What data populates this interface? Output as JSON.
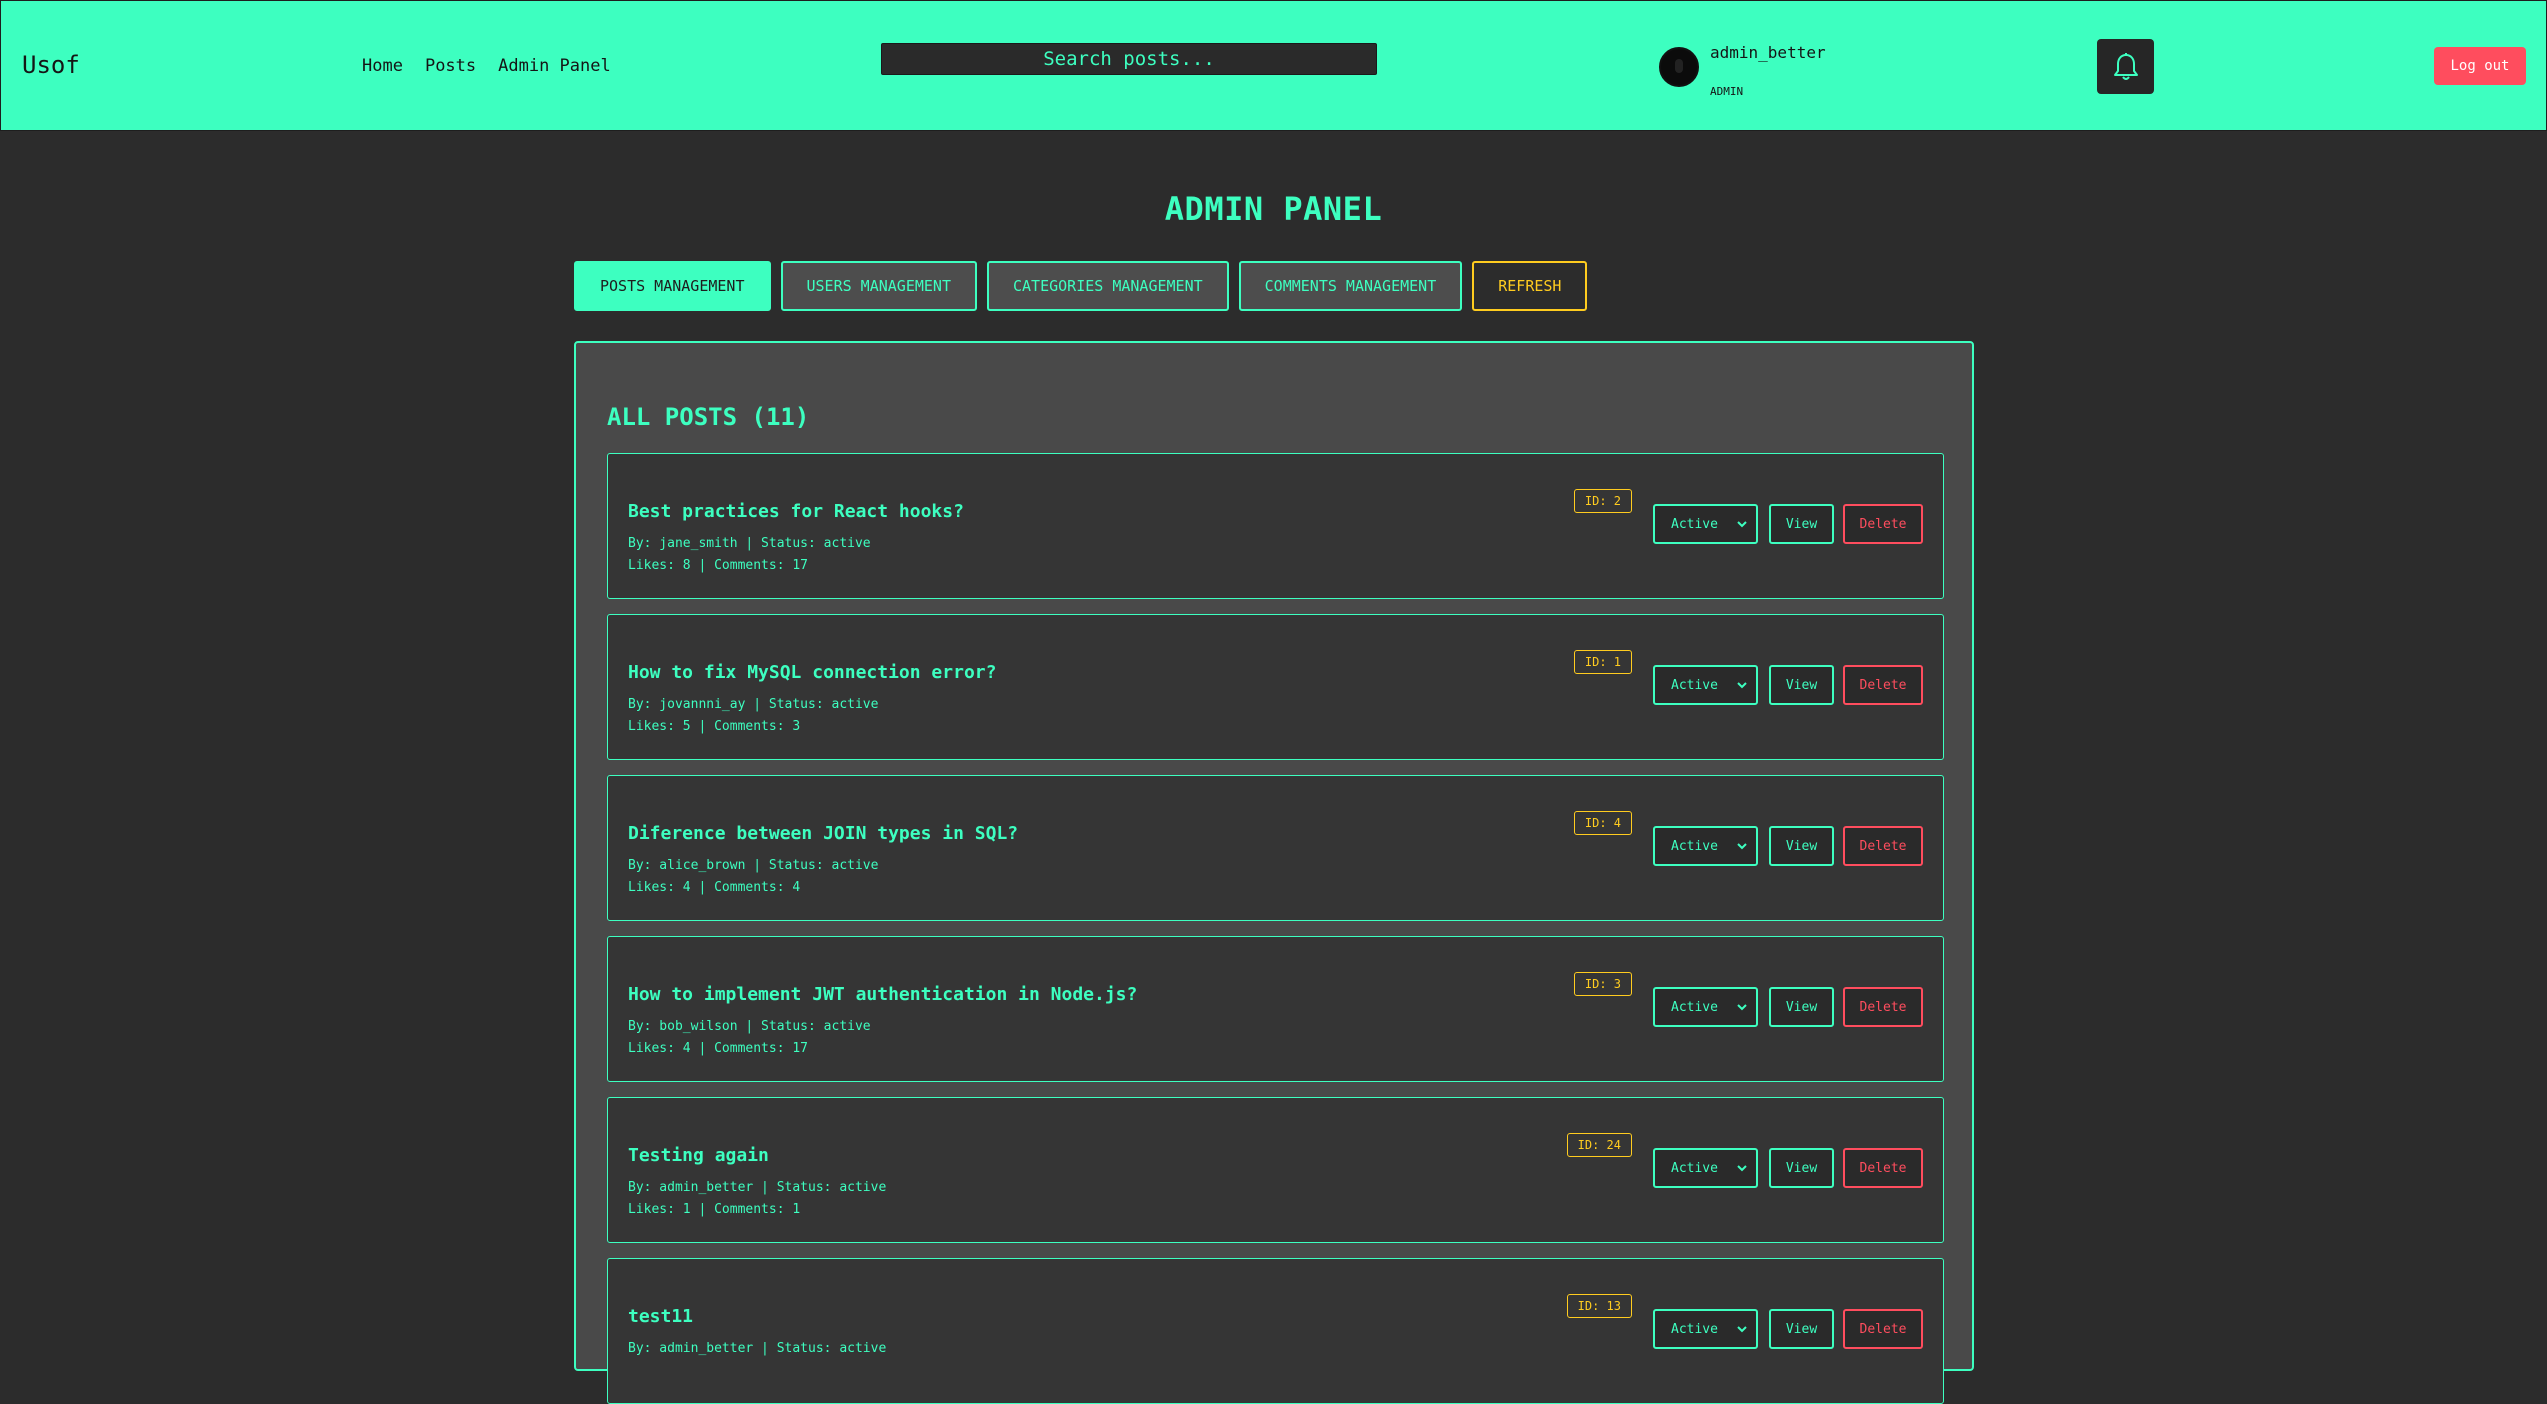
{
  "header": {
    "logo": "Usof",
    "nav": [
      "Home",
      "Posts",
      "Admin Panel"
    ],
    "search_placeholder": "Search posts...",
    "username": "admin_better",
    "role": "ADMIN",
    "logout_label": "Log out"
  },
  "page": {
    "title": "ADMIN PANEL",
    "tabs": [
      "POSTS MANAGEMENT",
      "USERS MANAGEMENT",
      "CATEGORIES MANAGEMENT",
      "COMMENTS MANAGEMENT",
      "REFRESH"
    ],
    "active_tab": "POSTS MANAGEMENT"
  },
  "posts_section": {
    "heading": "ALL POSTS (11)",
    "posts": [
      {
        "title": "Best practices for React hooks?",
        "meta": "By: jane_smith | Status: active",
        "stats": "Likes: 8 | Comments: 17",
        "id": "ID: 2",
        "status": "Active",
        "view": "View",
        "delete": "Delete"
      },
      {
        "title": "How to fix MySQL connection error?",
        "meta": "By: jovannni_ay | Status: active",
        "stats": "Likes: 5 | Comments: 3",
        "id": "ID: 1",
        "status": "Active",
        "view": "View",
        "delete": "Delete"
      },
      {
        "title": "Diference between JOIN types in SQL?",
        "meta": "By: alice_brown | Status: active",
        "stats": "Likes: 4 | Comments: 4",
        "id": "ID: 4",
        "status": "Active",
        "view": "View",
        "delete": "Delete"
      },
      {
        "title": "How to implement JWT authentication in Node.js?",
        "meta": "By: bob_wilson | Status: active",
        "stats": "Likes: 4 | Comments: 17",
        "id": "ID: 3",
        "status": "Active",
        "view": "View",
        "delete": "Delete"
      },
      {
        "title": "Testing again",
        "meta": "By: admin_better | Status: active",
        "stats": "Likes: 1 | Comments: 1",
        "id": "ID: 24",
        "status": "Active",
        "view": "View",
        "delete": "Delete"
      },
      {
        "title": "test11",
        "meta": "By: admin_better | Status: active",
        "stats": "",
        "id": "ID: 13",
        "status": "Active",
        "view": "View",
        "delete": "Delete"
      }
    ]
  },
  "colors": {
    "accent": "#3dffc0",
    "warning": "#ffcc1f",
    "danger": "#ff4d5e",
    "background": "#2c2c2c"
  },
  "icons": {
    "notifications": "bell-icon",
    "status_dropdown": "chevron-down-icon"
  }
}
